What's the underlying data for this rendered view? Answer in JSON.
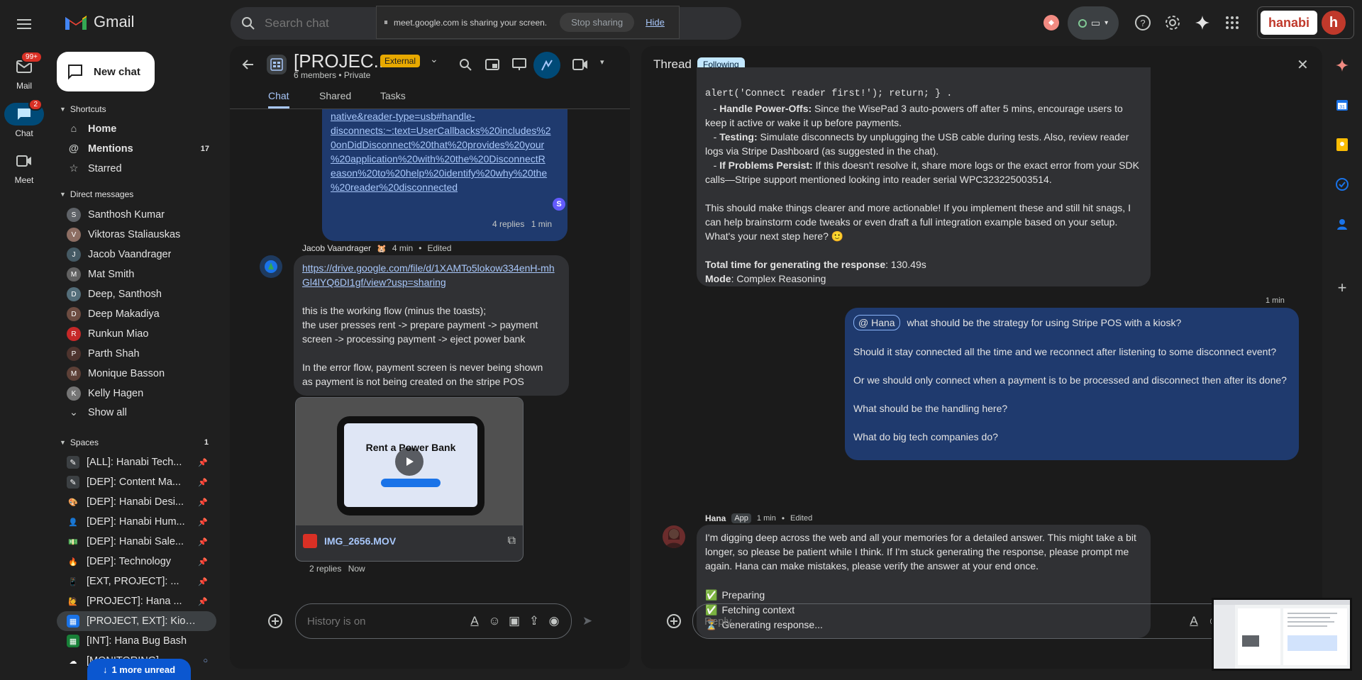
{
  "topbar": {
    "app_name": "Gmail",
    "search_placeholder": "Search chat",
    "share_notice": "meet.google.com is sharing your screen.",
    "stop_sharing": "Stop sharing",
    "hide": "Hide",
    "org_name": "hanabi",
    "org_initial": "h"
  },
  "rail": {
    "mail_label": "Mail",
    "mail_badge": "99+",
    "chat_label": "Chat",
    "chat_badge": "2",
    "meet_label": "Meet"
  },
  "sidebar": {
    "new_chat": "New chat",
    "shortcuts_header": "Shortcuts",
    "shortcuts": [
      {
        "label": "Home",
        "count": ""
      },
      {
        "label": "Mentions",
        "count": "17"
      },
      {
        "label": "Starred",
        "count": ""
      }
    ],
    "dm_header": "Direct messages",
    "dms": [
      {
        "name": "Santhosh Kumar",
        "color": "#5f6368",
        "initial": "S"
      },
      {
        "name": "Viktoras Staliauskas",
        "color": "#8d6e63",
        "initial": "V"
      },
      {
        "name": "Jacob Vaandrager",
        "color": "#455a64",
        "initial": "J"
      },
      {
        "name": "Mat Smith",
        "color": "#616161",
        "initial": "M"
      },
      {
        "name": "Deep, Santhosh",
        "color": "#546e7a",
        "initial": "D"
      },
      {
        "name": "Deep Makadiya",
        "color": "#6d4c41",
        "initial": "D"
      },
      {
        "name": "Runkun Miao",
        "color": "#c62828",
        "initial": "R"
      },
      {
        "name": "Parth Shah",
        "color": "#4e342e",
        "initial": "P"
      },
      {
        "name": "Monique Basson",
        "color": "#5d4037",
        "initial": "M"
      },
      {
        "name": "Kelly Hagen",
        "color": "#757575",
        "initial": "K"
      }
    ],
    "show_all": "Show all",
    "spaces_header": "Spaces",
    "spaces_count": "1",
    "spaces": [
      {
        "name": "[ALL]: Hanabi Tech...",
        "icon": "✎",
        "bg": "#3c4043"
      },
      {
        "name": "[DEP]: Content Ma...",
        "icon": "✎",
        "bg": "#3c4043"
      },
      {
        "name": "[DEP]: Hanabi Desi...",
        "icon": "🎨",
        "bg": "transparent"
      },
      {
        "name": "[DEP]: Hanabi Hum...",
        "icon": "👤",
        "bg": "transparent"
      },
      {
        "name": "[DEP]: Hanabi Sale...",
        "icon": "💵",
        "bg": "transparent"
      },
      {
        "name": "[DEP]: Technology",
        "icon": "🔥",
        "bg": "transparent"
      },
      {
        "name": "[EXT, PROJECT]: ...",
        "icon": "📱",
        "bg": "transparent"
      },
      {
        "name": "[PROJECT]: Hana ...",
        "icon": "🙋",
        "bg": "transparent"
      },
      {
        "name": "[PROJECT, EXT]: Kiosk...",
        "icon": "▦",
        "bg": "#1a73e8"
      },
      {
        "name": "[INT]: Hana Bug Bash",
        "icon": "▦",
        "bg": "#188038"
      },
      {
        "name": "[MONITORING]",
        "icon": "☁",
        "bg": "transparent"
      }
    ],
    "more_unread": "1 more unread"
  },
  "chat": {
    "title": "[PROJEC...",
    "external": "External",
    "members": "6 members",
    "privacy": "Private",
    "tabs": [
      "Chat",
      "Shared",
      "Tasks"
    ],
    "link_fragment_lines": [
      "native&reader-type=usb#handle-",
      "disconnects:~:text=UserCallbacks%20includes%2",
      "0onDidDisconnect%20that%20provides%20your",
      "%20application%20with%20the%20DisconnectR",
      "eason%20to%20help%20identify%20why%20the",
      "%20reader%20disconnected"
    ],
    "replies_1": "4 replies",
    "replies_1_time": "1 min",
    "msg_author": "Jacob Vaandrager",
    "msg_time": "4 min",
    "msg_edited": "Edited",
    "msg_link": "https://drive.google.com/file/d/1XAMTo5lokow334enH-mhGl4lYQ6DI1gf/view?usp=sharing",
    "msg_lines": [
      "this is the working flow (minus the toasts);",
      "the user presses rent -> prepare payment -> payment",
      "screen -> processing payment -> eject power bank",
      "",
      "In the error flow, payment screen is never being shown",
      "as payment is not being created on the stripe POS"
    ],
    "video_headline": "Rent a Power Bank",
    "video_file": "IMG_2656.MOV",
    "replies_2": "2 replies",
    "replies_2_time": "Now",
    "composer_placeholder": "History is on"
  },
  "thread": {
    "title": "Thread",
    "following": "Following",
    "bot_code_line": "alert('Connect reader first!'); return; } .",
    "bot_items": [
      {
        "head": "Handle Power-Offs:",
        "body": " Since the WisePad 3 auto-powers off after 5 mins, encourage users to keep it active or wake it up before payments."
      },
      {
        "head": "Testing:",
        "body": " Simulate disconnects by unplugging the USB cable during tests. Also, review reader logs via Stripe Dashboard (as suggested in the chat)."
      },
      {
        "head": "If Problems Persist:",
        "body": " If this doesn't resolve it, share more logs or the exact error from your SDK calls—Stripe support mentioned looking into reader serial WPC323225003514."
      }
    ],
    "bot_closing": "This should make things clearer and more actionable! If you implement these and still hit snags, I can help brainstorm code tweaks or even draft a full integration example based on your setup. What's your next step here? 🙂",
    "total_time_label": "Total time for generating the response",
    "total_time_value": ": 130.49s",
    "mode_label": "Mode",
    "mode_value": ": Complex Reasoning",
    "user_time": "1 min",
    "mention": "@ Hana",
    "user_q1": " what should be the strategy for using Stripe POS with a kiosk?",
    "user_q2": "Should it stay connected all the time and we reconnect after listening to some disconnect event?",
    "user_q3": "Or we should only connect when a payment is to be processed and disconnect then after its done?",
    "user_q4": "What should be the handling here?",
    "user_q5": "What do big tech companies do?",
    "hana_name": "Hana",
    "hana_app": "App",
    "hana_time": "1 min",
    "hana_edited": "Edited",
    "hana_text": "I'm digging deep across the web and all your memories for a detailed answer. This might take a bit longer, so please be patient while I think. If I'm stuck generating the response, please prompt me again. Hana can make mistakes, please verify the answer at your end once.",
    "steps": [
      {
        "icon": "✅",
        "label": "Preparing"
      },
      {
        "icon": "✅",
        "label": "Fetching context"
      },
      {
        "icon": "⏳",
        "label": "Generating response..."
      }
    ],
    "reply_placeholder": "Reply"
  },
  "colors": {
    "accent": "#a8c7fa",
    "user_bubble": "#1f3a6e",
    "external_badge": "#e8a900",
    "following_badge": "#c2e7ff"
  }
}
